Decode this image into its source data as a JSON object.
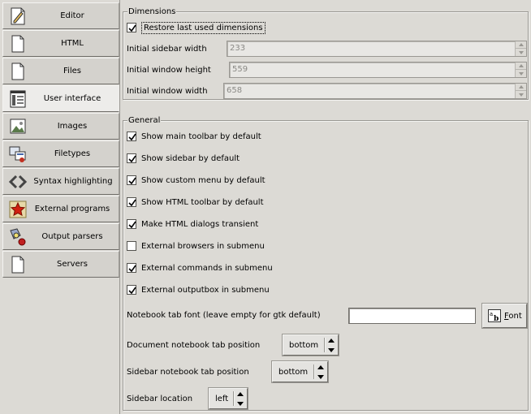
{
  "sidebar": {
    "items": [
      {
        "label": "Editor",
        "icon": "editor-icon"
      },
      {
        "label": "HTML",
        "icon": "html-document-icon"
      },
      {
        "label": "Files",
        "icon": "files-document-icon"
      },
      {
        "label": "User interface",
        "icon": "user-interface-icon",
        "selected": true
      },
      {
        "label": "Images",
        "icon": "images-icon"
      },
      {
        "label": "Filetypes",
        "icon": "filetypes-icon"
      },
      {
        "label": "Syntax highlighting",
        "icon": "syntax-highlighting-icon"
      },
      {
        "label": "External programs",
        "icon": "external-programs-icon"
      },
      {
        "label": "Output parsers",
        "icon": "output-parsers-icon"
      },
      {
        "label": "Servers",
        "icon": "servers-document-icon"
      }
    ]
  },
  "dimensions": {
    "legend": "Dimensions",
    "restore_label": "Restore last used dimensions",
    "restore_checked": true,
    "sidebar_width_label": "Initial sidebar width",
    "sidebar_width_value": "233",
    "window_height_label": "Initial window height",
    "window_height_value": "559",
    "window_width_label": "Initial window width",
    "window_width_value": "658"
  },
  "general": {
    "legend": "General",
    "checkboxes": [
      {
        "label": "Show main toolbar by default",
        "checked": true
      },
      {
        "label": "Show sidebar by default",
        "checked": true
      },
      {
        "label": "Show custom menu by default",
        "checked": true
      },
      {
        "label": "Show HTML toolbar by default",
        "checked": true
      },
      {
        "label": "Make HTML dialogs transient",
        "checked": true
      },
      {
        "label": "External browsers in submenu",
        "checked": false
      },
      {
        "label": "External commands in submenu",
        "checked": true
      },
      {
        "label": "External outputbox in submenu",
        "checked": true
      }
    ],
    "tab_font_label": "Notebook tab font (leave empty for gtk default)",
    "tab_font_value": "",
    "font_button_prefix": "",
    "font_button_mnemonic": "F",
    "font_button_rest": "ont",
    "doc_tab_pos_label": "Document notebook tab position",
    "doc_tab_pos_value": "bottom",
    "sidebar_tab_pos_label": "Sidebar notebook tab position",
    "sidebar_tab_pos_value": "bottom",
    "sidebar_location_label": "Sidebar location",
    "sidebar_location_value": "left"
  },
  "colors": {
    "background": "#dcdad5",
    "selected_tab": "#edecea"
  }
}
